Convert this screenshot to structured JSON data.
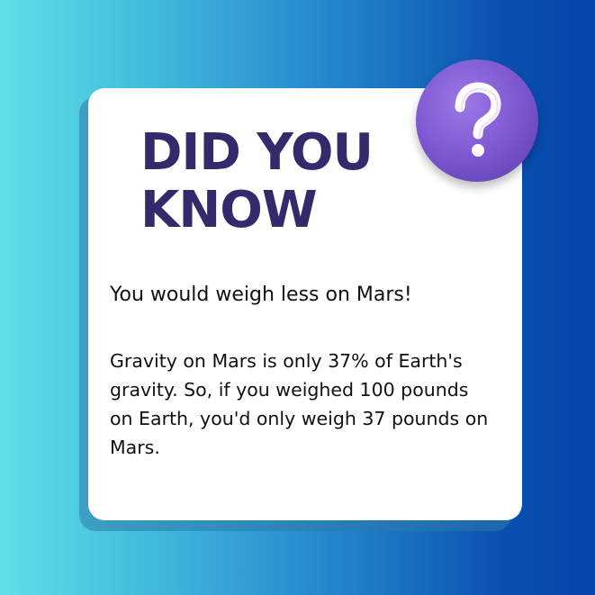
{
  "headline": {
    "line1": "DID YOU",
    "line2": "KNOW"
  },
  "subtitle": "You would weigh less on Mars!",
  "body_text": "Gravity on Mars is only 37% of Earth's gravity. So, if you weighed 100 pounds on Earth, you'd only weigh 37 pounds on Mars.",
  "badge": {
    "icon": "question-mark-icon",
    "color": "#7a55cf"
  },
  "colors": {
    "background_start": "#5fe0e6",
    "background_end": "#0645aa",
    "card": "#ffffff",
    "headline": "#322a6b",
    "text": "#111111"
  }
}
